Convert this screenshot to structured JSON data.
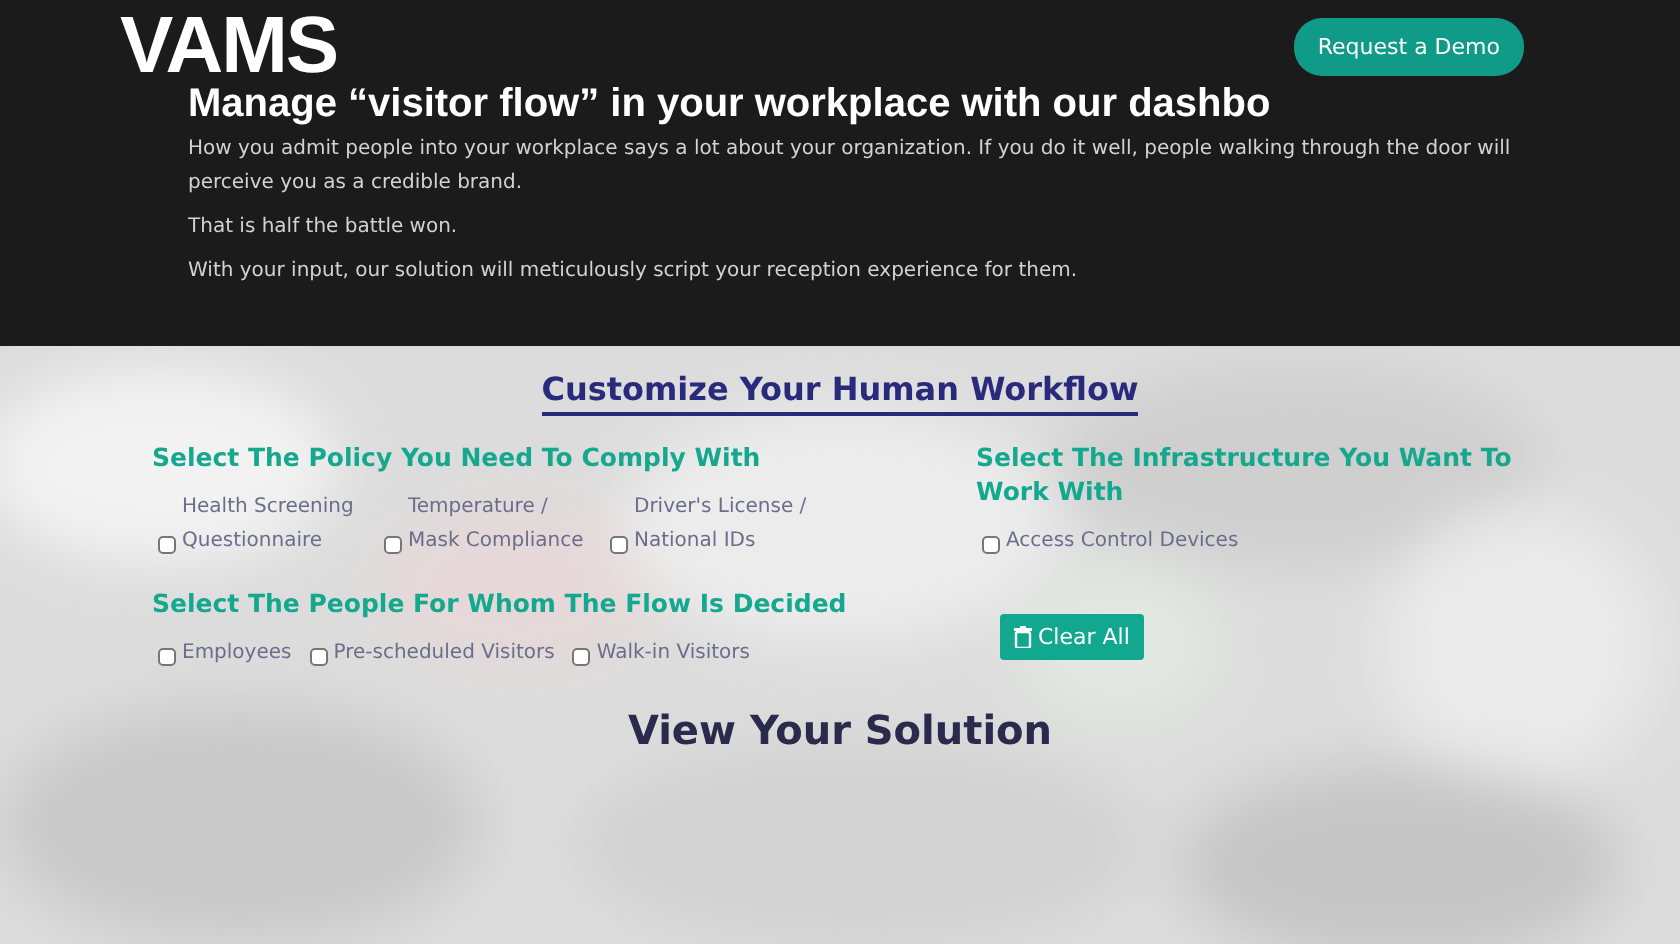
{
  "header": {
    "logo": "VAMS",
    "heading": "Manage “visitor flow” in your workplace with our dashbo",
    "demo_button": "Request a Demo"
  },
  "intro": [
    "How you admit people into your workplace says a lot about your organization. If you do it well, people walking through the door will perceive you as a credible brand.",
    "That is half the battle won.",
    "With your input, our solution will meticulously script your reception experience for them."
  ],
  "customize": {
    "title": "Customize Your Human Workflow",
    "policy": {
      "title": "Select The Policy You Need To Comply With",
      "options": [
        {
          "label": "Health Screening Questionnaire",
          "checked": false
        },
        {
          "label": "Temperature / Mask Compliance",
          "checked": false
        },
        {
          "label": "Driver's License / National IDs",
          "checked": false
        }
      ]
    },
    "people": {
      "title": "Select The People For Whom The Flow Is Decided",
      "options": [
        {
          "label": "Employees",
          "checked": false
        },
        {
          "label": "Pre-scheduled Visitors",
          "checked": false
        },
        {
          "label": "Walk-in Visitors",
          "checked": false
        }
      ]
    },
    "infrastructure": {
      "title": "Select The Infrastructure You Want To Work With",
      "options": [
        {
          "label": "Access Control Devices",
          "checked": false
        }
      ]
    },
    "clear_button": "Clear All"
  },
  "solution": {
    "title": "View Your Solution"
  }
}
